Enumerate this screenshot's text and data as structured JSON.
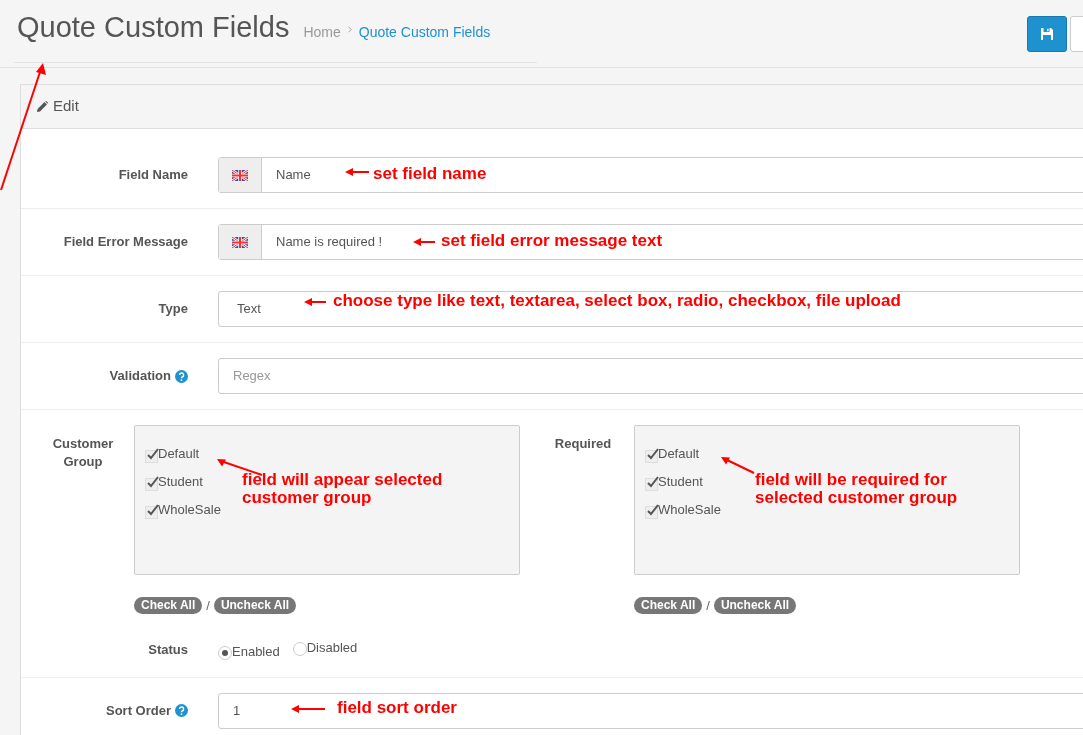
{
  "header": {
    "title": "Quote Custom Fields",
    "breadcrumb": [
      {
        "label": "Home",
        "active": false
      },
      {
        "label": "Quote Custom Fields",
        "active": true
      }
    ],
    "buttons": [
      {
        "kind": "save"
      },
      {
        "kind": "plain"
      }
    ]
  },
  "panel": {
    "title": "Edit"
  },
  "fields": [
    {
      "kind": "lang-input",
      "label": "Field Name",
      "value": "Name",
      "annotation": "set field name"
    },
    {
      "kind": "lang-input",
      "label": "Field Error Message",
      "value": "Name is required !",
      "annotation": "set field error message text"
    },
    {
      "kind": "select",
      "label": "Type",
      "value": "Text",
      "annotation": "choose type like text, textarea, select box, radio, checkbox, file upload"
    },
    {
      "kind": "input",
      "label": "Validation",
      "help": true,
      "placeholder": "Regex"
    }
  ],
  "groups": [
    {
      "label": "Customer Group",
      "options": [
        {
          "label": "Default",
          "checked": true
        },
        {
          "label": "Student",
          "checked": true
        },
        {
          "label": "WholeSale",
          "checked": true
        }
      ],
      "buttons": [
        "Check All",
        "Uncheck All"
      ],
      "separator": "/",
      "annotation": "field will appear selected customer group"
    },
    {
      "label": "Required",
      "options": [
        {
          "label": "Default",
          "checked": true
        },
        {
          "label": "Student",
          "checked": true
        },
        {
          "label": "WholeSale",
          "checked": true
        }
      ],
      "buttons": [
        "Check All",
        "Uncheck All"
      ],
      "separator": "/",
      "annotation": "field will be required for selected customer group"
    }
  ],
  "status": {
    "label": "Status",
    "options": [
      {
        "label": "Enabled",
        "selected": true
      },
      {
        "label": "Disabled",
        "selected": false
      }
    ]
  },
  "sort_order": {
    "kind": "input",
    "label": "Sort Order",
    "help": true,
    "value": "1",
    "annotation": "field sort order"
  }
}
